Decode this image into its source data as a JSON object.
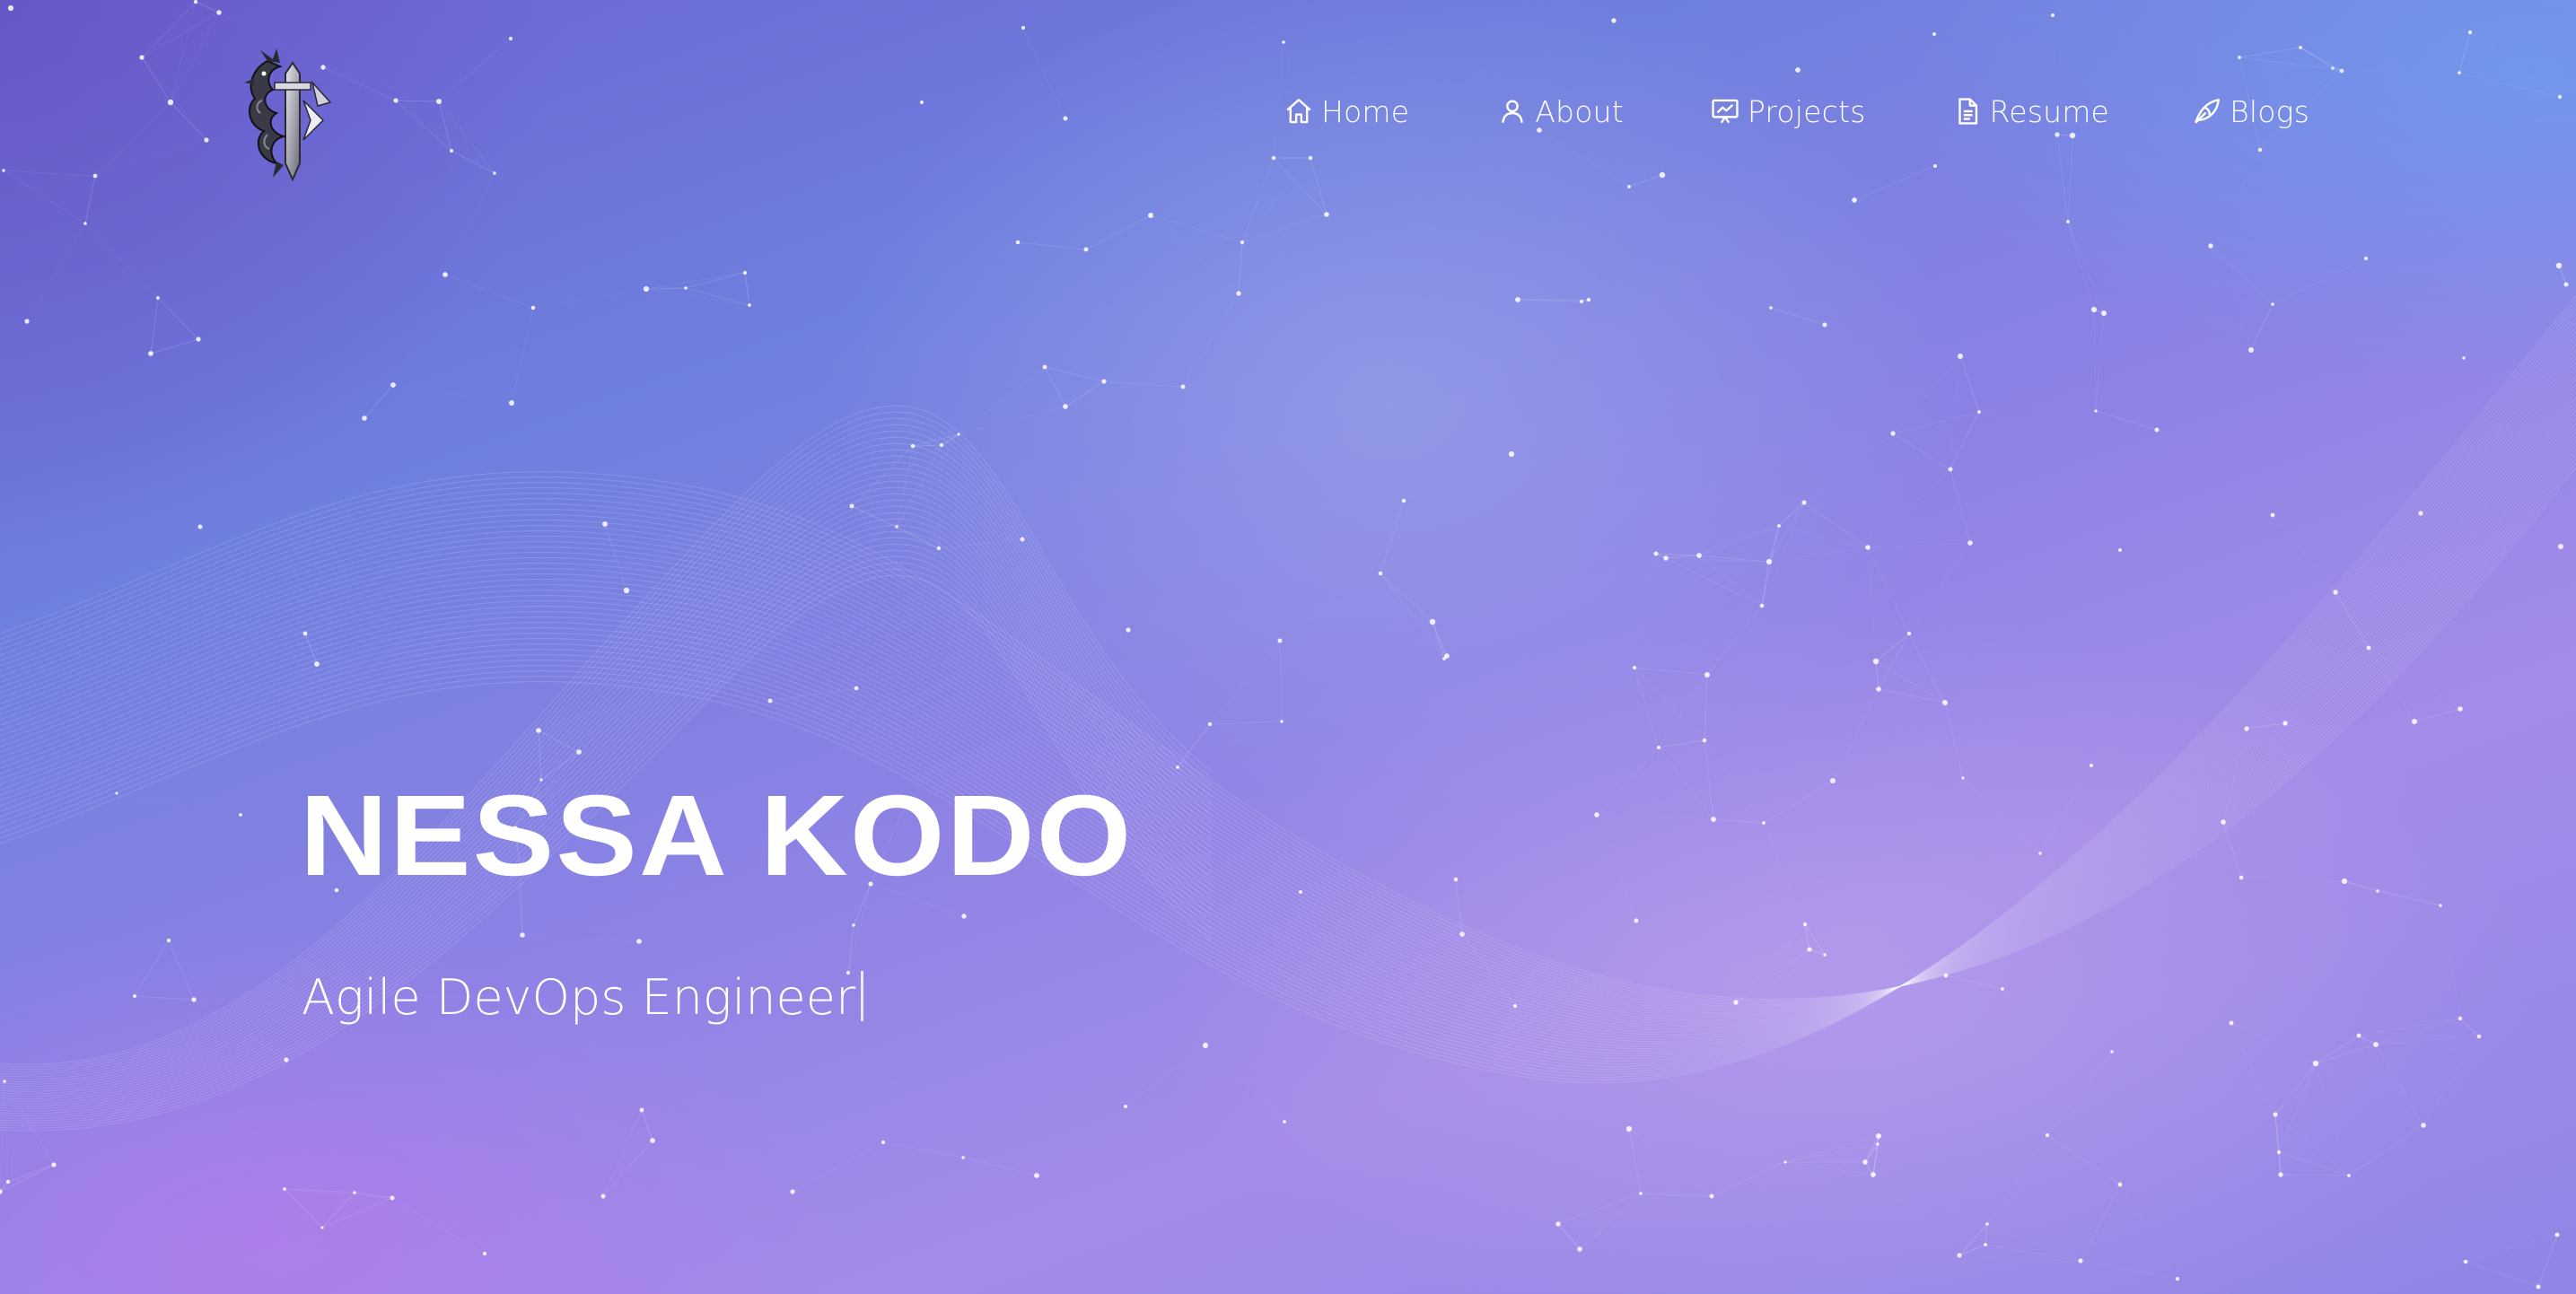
{
  "site": {
    "owner_name": "NESSA KODO",
    "tagline": "Agile DevOps Engineer"
  },
  "logo": {
    "icon": "dragon-sword-icon"
  },
  "nav": {
    "items": [
      {
        "label": "Home",
        "icon": "home-icon"
      },
      {
        "label": "About",
        "icon": "user-icon"
      },
      {
        "label": "Projects",
        "icon": "presentation-chart-icon"
      },
      {
        "label": "Resume",
        "icon": "document-icon"
      },
      {
        "label": "Blogs",
        "icon": "quill-icon"
      }
    ]
  },
  "colors": {
    "gradient_start": "#6c63d4",
    "gradient_mid": "#8a82e4",
    "gradient_end": "#a48be8",
    "text": "#ffffff"
  }
}
